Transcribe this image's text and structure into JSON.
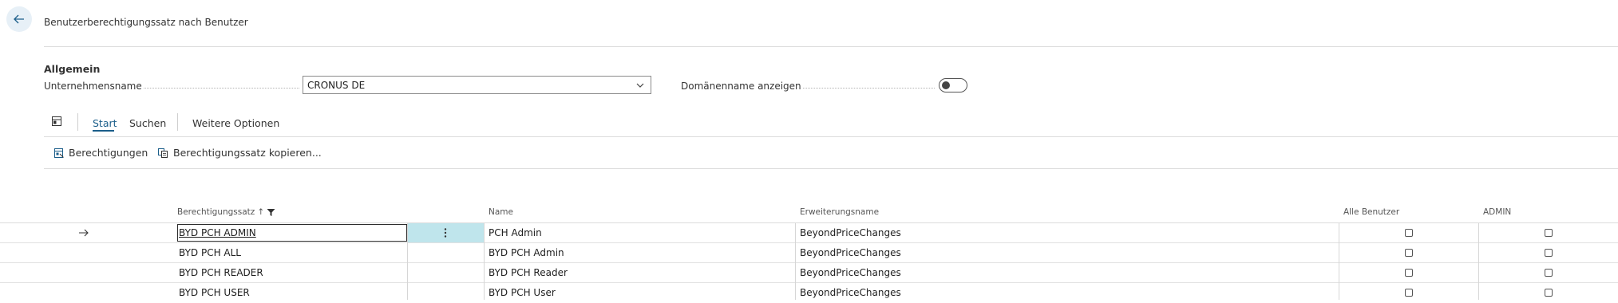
{
  "header": {
    "title": "Benutzerberechtigungssatz nach Benutzer"
  },
  "general": {
    "section_title": "Allgemein",
    "company_label": "Unternehmensname",
    "company_value": "CRONUS DE",
    "domain_label": "Domänenname anzeigen",
    "domain_toggle_on": false
  },
  "toolbar": {
    "tabs": [
      "Start",
      "Suchen",
      "Weitere Optionen"
    ],
    "active_tab": "Start"
  },
  "actions": [
    {
      "label": "Berechtigungen",
      "icon": "permissions-icon"
    },
    {
      "label": "Berechtigungssatz kopieren...",
      "icon": "copy-icon"
    }
  ],
  "table": {
    "columns": [
      "Berechtigungssatz",
      "Name",
      "Erweiterungsname",
      "Alle Benutzer",
      "ADMIN"
    ],
    "sort_indicator": "↑",
    "rows": [
      {
        "set": "BYD PCH ADMIN",
        "name": "PCH Admin",
        "extension": "BeyondPriceChanges",
        "all_users": false,
        "admin": false
      },
      {
        "set": "BYD PCH ALL",
        "name": "BYD PCH Admin",
        "extension": "BeyondPriceChanges",
        "all_users": false,
        "admin": false
      },
      {
        "set": "BYD PCH READER",
        "name": "BYD PCH Reader",
        "extension": "BeyondPriceChanges",
        "all_users": false,
        "admin": false
      },
      {
        "set": "BYD PCH USER",
        "name": "BYD PCH User",
        "extension": "BeyondPriceChanges",
        "all_users": false,
        "admin": false
      }
    ]
  },
  "colors": {
    "accent": "#1b5e8a",
    "selected_cell": "#bfe5ec"
  }
}
